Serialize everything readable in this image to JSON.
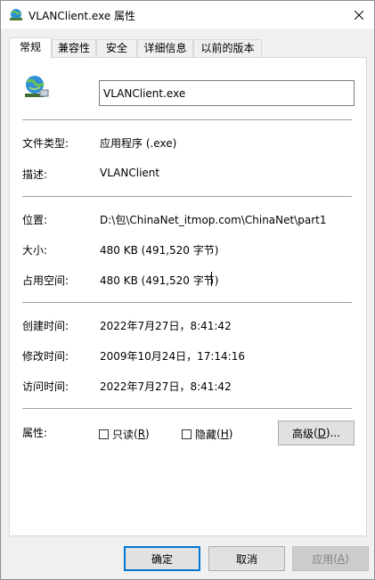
{
  "window": {
    "title": "VLANClient.exe 属性",
    "icon": "network-globe-icon"
  },
  "tabs": [
    {
      "label": "常规",
      "active": true
    },
    {
      "label": "兼容性",
      "active": false
    },
    {
      "label": "安全",
      "active": false
    },
    {
      "label": "详细信息",
      "active": false
    },
    {
      "label": "以前的版本",
      "active": false
    }
  ],
  "general": {
    "file_name": "VLANClient.exe",
    "rows": {
      "file_type_label": "文件类型:",
      "file_type_value": "应用程序 (.exe)",
      "description_label": "描述:",
      "description_value": "VLANClient",
      "location_label": "位置:",
      "location_value": "D:\\包\\ChinaNet_itmop.com\\ChinaNet\\part1",
      "size_label": "大小:",
      "size_value": "480 KB (491,520 字节)",
      "size_on_disk_label": "占用空间:",
      "size_on_disk_value": "480 KB (491,520 字节)",
      "created_label": "创建时间:",
      "created_value": "2022年7月27日，8:41:42",
      "modified_label": "修改时间:",
      "modified_value": "2009年10月24日，17:14:16",
      "accessed_label": "访问时间:",
      "accessed_value": "2022年7月27日，8:41:42",
      "attributes_label": "属性:"
    },
    "attributes": {
      "readonly_label": "只读",
      "readonly_key": "R",
      "readonly_checked": false,
      "hidden_label": "隐藏",
      "hidden_key": "H",
      "hidden_checked": false,
      "advanced_label": "高级",
      "advanced_key": "D",
      "advanced_suffix": "..."
    }
  },
  "footer": {
    "ok_label": "确定",
    "cancel_label": "取消",
    "apply_label": "应用",
    "apply_key": "A"
  }
}
